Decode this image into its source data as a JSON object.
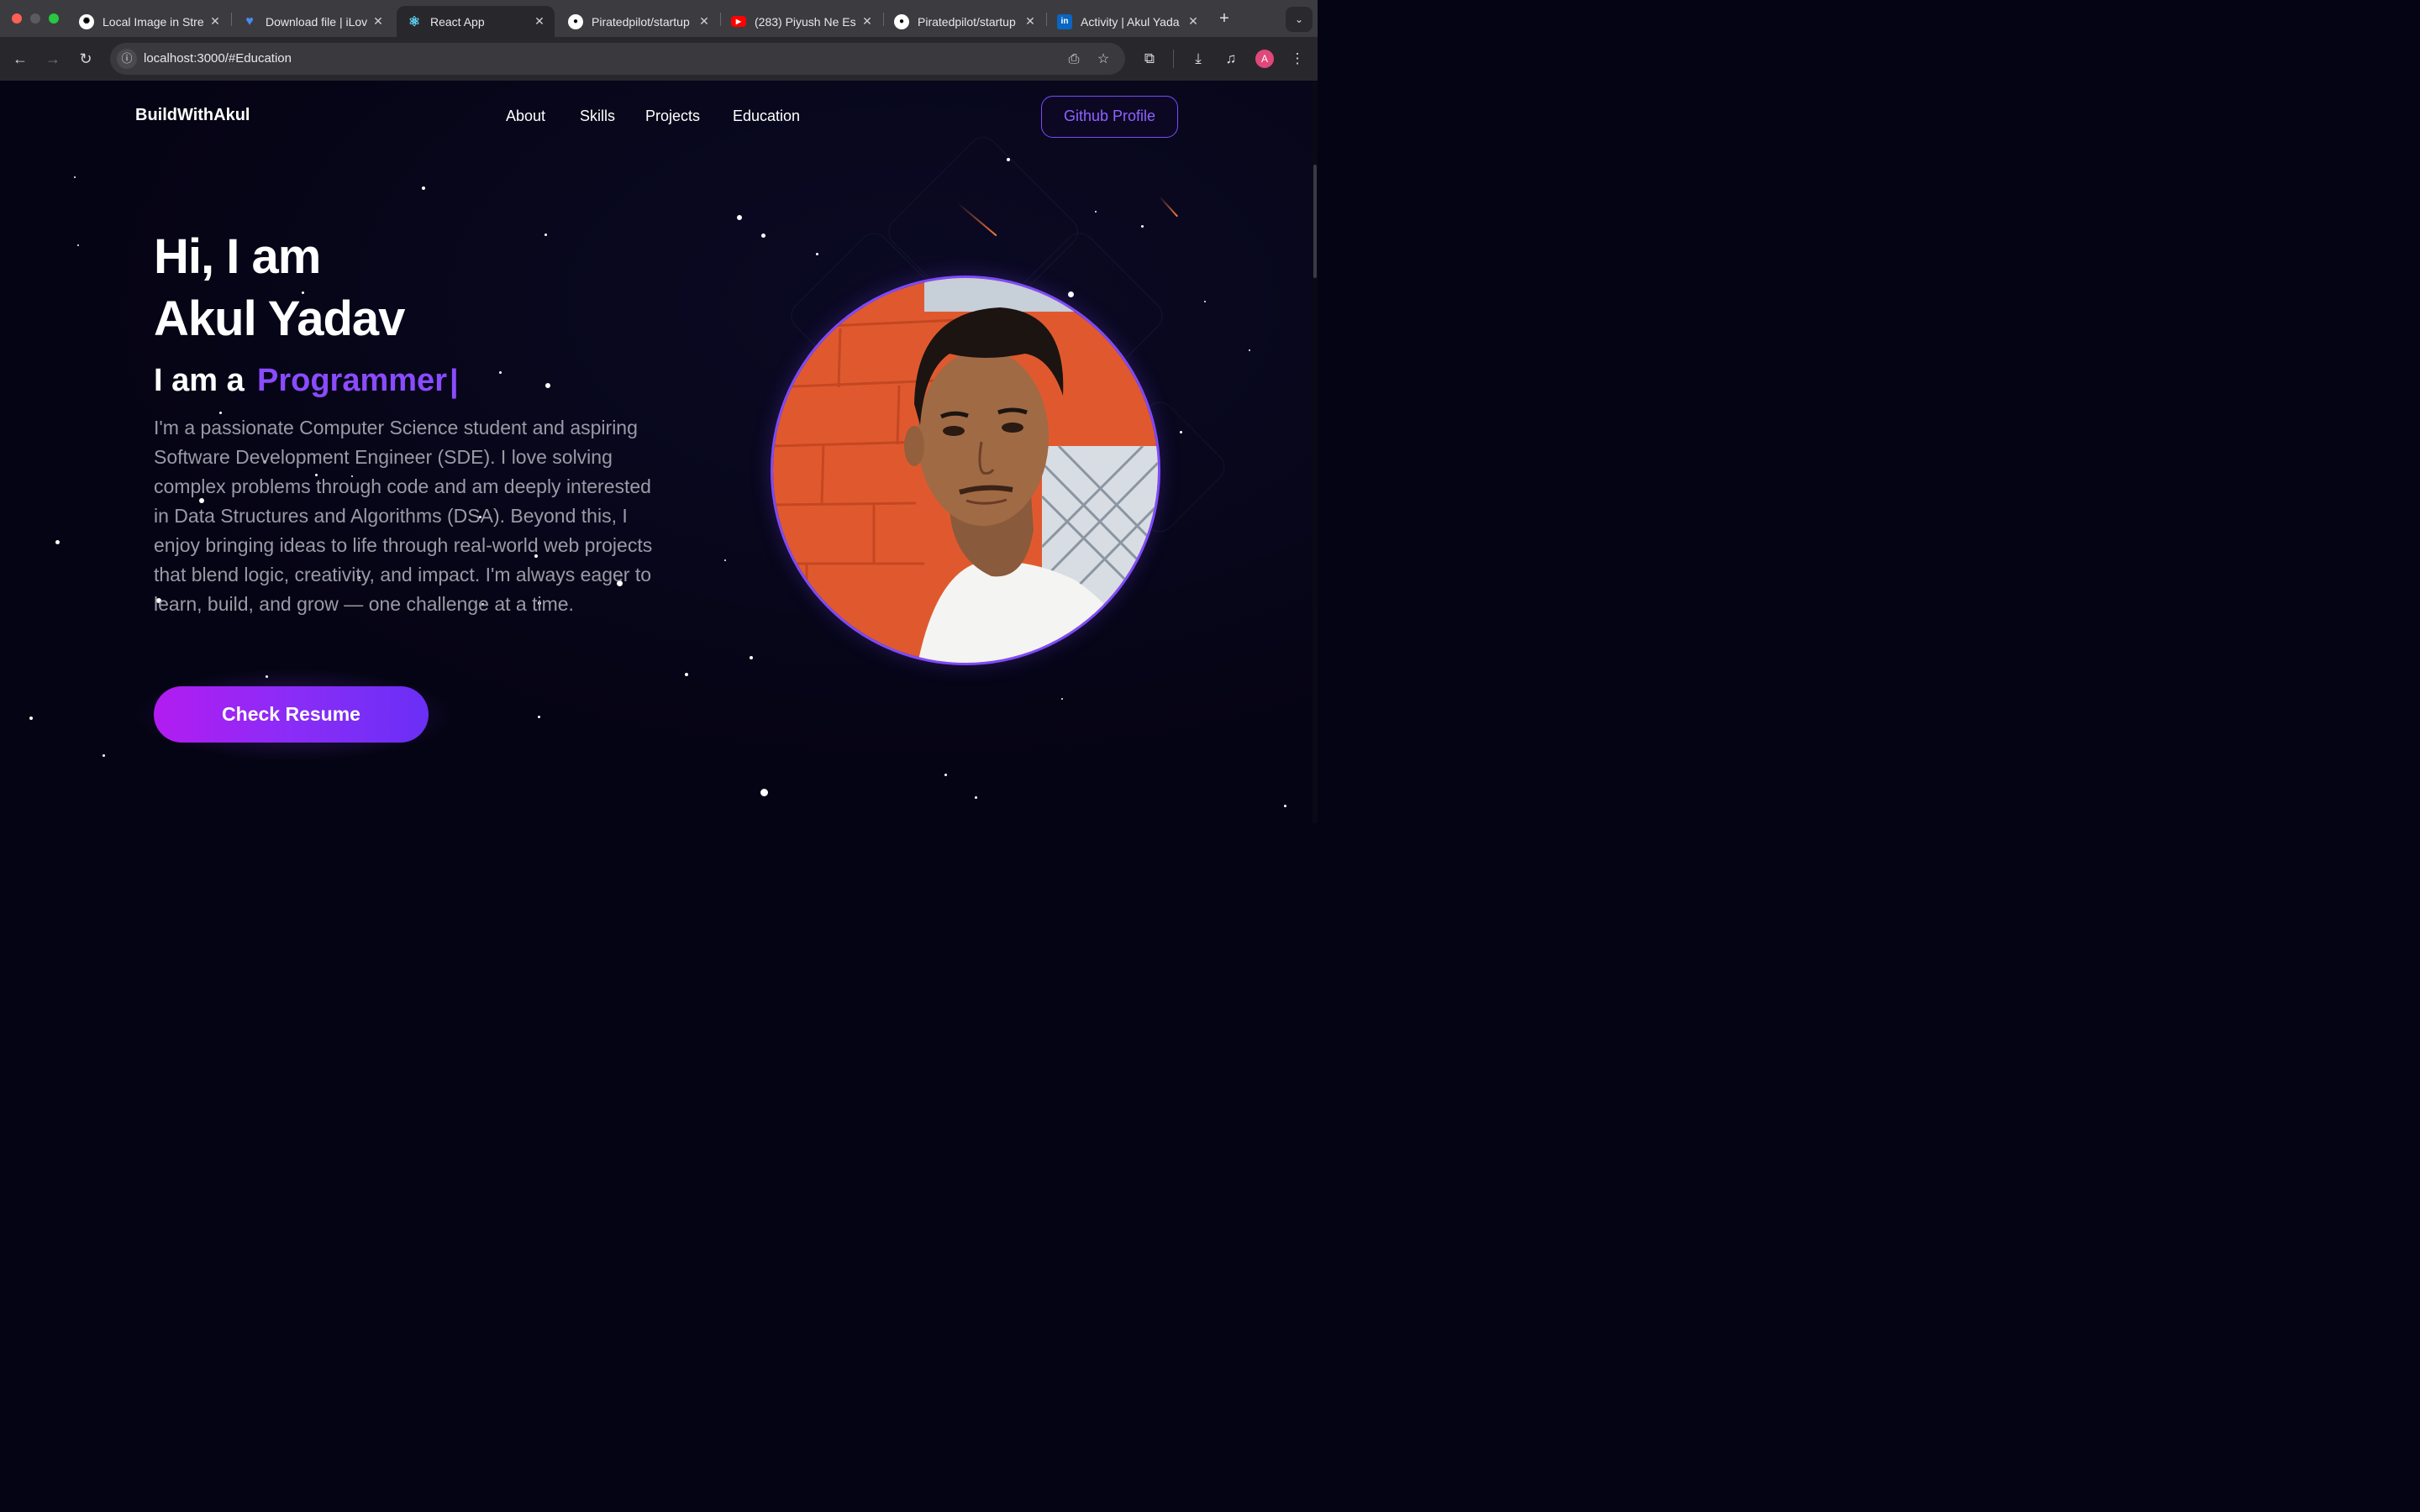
{
  "browser": {
    "tabs": [
      {
        "title": "Local Image in Stre",
        "icon": "openai-icon"
      },
      {
        "title": "Download file | iLov",
        "icon": "ilovepdf-heart-icon"
      },
      {
        "title": "React App",
        "icon": "react-icon"
      },
      {
        "title": "Piratedpilot/startup",
        "icon": "github-icon"
      },
      {
        "title": "(283) Piyush Ne Es",
        "icon": "youtube-icon"
      },
      {
        "title": "Piratedpilot/startup",
        "icon": "github-icon"
      },
      {
        "title": "Activity | Akul Yada",
        "icon": "linkedin-icon"
      }
    ],
    "active_tab": 2,
    "url": "localhost:3000/#Education",
    "profile_initial": "A"
  },
  "nav": {
    "brand": "BuildWithAkul",
    "links": [
      "About",
      "Skills",
      "Projects",
      "Education"
    ],
    "github_button": "Github Profile"
  },
  "hero": {
    "greeting": "Hi, I am",
    "name": "Akul Yadav",
    "role_prefix": "I am a",
    "role": "Programmer",
    "caret": "|",
    "bio": "I'm a passionate Computer Science student and aspiring Software Development Engineer (SDE). I love solving complex problems through code and am deeply interested in Data Structures and Algorithms (DSA). Beyond this, I enjoy bringing ideas to life through real-world web projects that blend logic, creativity, and impact. I'm always eager to learn, build, and grow — one challenge at a time.",
    "resume_button": "Check Resume"
  },
  "colors": {
    "accent": "#8a4bff",
    "background": "#050414",
    "button_gradient_start": "#b21cf0",
    "button_gradient_end": "#6a2ff5"
  }
}
